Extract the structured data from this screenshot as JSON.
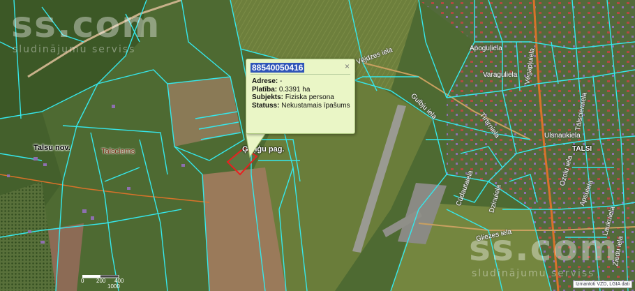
{
  "watermark": {
    "brand": "ss.com",
    "tagline": "sludinājumu serviss"
  },
  "map_labels": {
    "region": "Talsu nov.",
    "village": "Talsciems",
    "parish": "Ģeņģu pag.",
    "city": "TALSI"
  },
  "streets": [
    "Vējdzes iela",
    "Apoguļiela",
    "Varagulіela",
    "Vēgapļuiela",
    "Gulbju iela",
    "Tīrtirņiela",
    "Ulsnaukiela",
    "Tālsciemiela",
    "Ozolu iela",
    "Cūdautaiela",
    "Dzinuiela",
    "Gliezes iela",
    "Apsuiela",
    "Laukuiela",
    "Ziedu iela"
  ],
  "popup": {
    "cadastre_number": "88540050416",
    "close_symbol": "×",
    "address_label": "Adrese:",
    "address_value": "-",
    "area_label": "Platība:",
    "area_value": "0.3391 ha",
    "subject_label": "Subjekts:",
    "subject_value": "Fiziska persona",
    "status_label": "Statuss:",
    "status_value": "Nekustamais īpašums"
  },
  "scale": {
    "labels": [
      "0",
      "200",
      "400"
    ],
    "value": "1000"
  },
  "attribution": "Izmantoti VZD, LGIA dati",
  "colors": {
    "parcel_boundary": "#35e8ec",
    "selected_parcel": "#e82020",
    "road": "#d9722a",
    "popup_background": "#eaf6c6",
    "popup_title_highlight": "#2f55b8"
  }
}
